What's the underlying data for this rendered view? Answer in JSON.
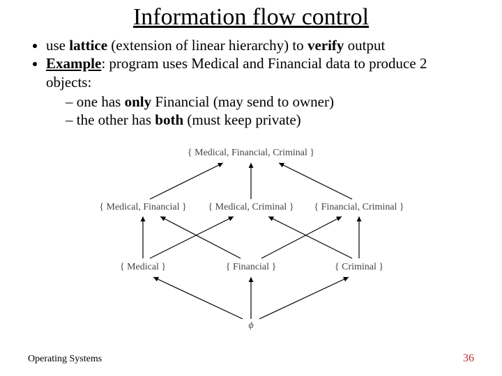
{
  "title": "Information flow control",
  "bullets": {
    "b1_pre": "use ",
    "b1_bold1": "lattice",
    "b1_mid": " (extension of linear hierarchy) to ",
    "b1_bold2": "verify",
    "b1_post": " output",
    "b2_bold": "Example",
    "b2_rest": ": program uses Medical and Financial data to produce 2 objects:",
    "b2a_pre": "one has ",
    "b2a_bold": "only",
    "b2a_post": " Financial (may send to owner)",
    "b2b_pre": "the other has ",
    "b2b_bold": "both",
    "b2b_post": " (must keep private)"
  },
  "lattice": {
    "top": "{ Medical, Financial, Criminal }",
    "mid_left": "{ Medical, Financial }",
    "mid_center": "{ Medical, Criminal }",
    "mid_right": "{ Financial, Criminal }",
    "low_left": "{ Medical }",
    "low_center": "{ Financial }",
    "low_right": "{ Criminal }",
    "bottom": "ϕ"
  },
  "footer": {
    "left": "Operating Systems",
    "right": "36"
  }
}
